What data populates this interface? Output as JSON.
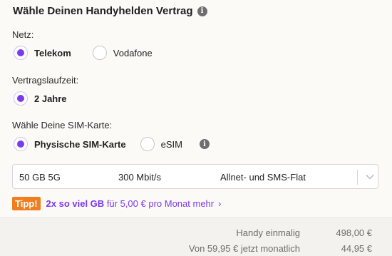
{
  "title": "Wähle Deinen Handyhelden Vertrag",
  "info_icon": "i",
  "netz": {
    "label": "Netz:",
    "options": [
      {
        "label": "Telekom",
        "selected": true
      },
      {
        "label": "Vodafone",
        "selected": false
      }
    ]
  },
  "laufzeit": {
    "label": "Vertragslaufzeit:",
    "options": [
      {
        "label": "2 Jahre",
        "selected": true
      }
    ]
  },
  "sim": {
    "label": "Wähle Deine SIM-Karte:",
    "options": [
      {
        "label": "Physische SIM-Karte",
        "selected": true
      },
      {
        "label": "eSIM",
        "selected": false
      }
    ],
    "info_icon": "i"
  },
  "tariff_select": {
    "data": "50 GB 5G",
    "speed": "300 Mbit/s",
    "flat": "Allnet- und SMS-Flat"
  },
  "tipp": {
    "badge": "Tipp!",
    "highlight": "2x so viel GB",
    "text": "für 5,00 € pro Monat mehr",
    "chevron": "›"
  },
  "summary": {
    "row1_label": "Handy einmalig",
    "row1_value": "498,00 €",
    "row2_label": "Von 59,95 € jetzt monatlich",
    "row2_value": "44,95 €"
  },
  "colors": {
    "accent": "#7c3aed",
    "tipp_badge": "#f07d1f"
  }
}
